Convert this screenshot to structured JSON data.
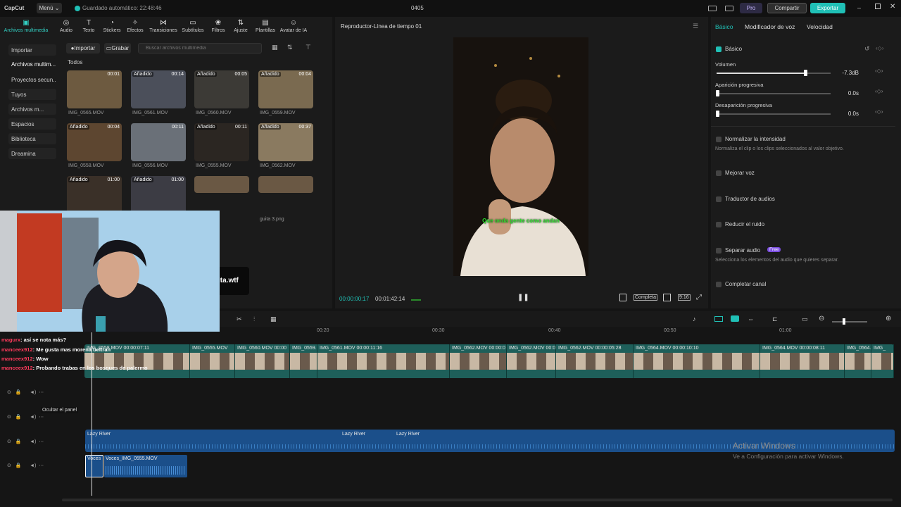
{
  "titlebar": {
    "logo": "CapCut",
    "menu_label": "Menú",
    "autosave": "Guardado automático: 22:48:46",
    "project_name": "0405",
    "pro_label": "Pro",
    "share_label": "Compartir",
    "export_label": "Exportar"
  },
  "toolbar": {
    "tools": [
      {
        "icon": "media-icon",
        "label": "Archivos multimedia"
      },
      {
        "icon": "audio-icon",
        "label": "Audio"
      },
      {
        "icon": "text-icon",
        "label": "Texto"
      },
      {
        "icon": "stickers-icon",
        "label": "Stickers"
      },
      {
        "icon": "effects-icon",
        "label": "Efectos"
      },
      {
        "icon": "transitions-icon",
        "label": "Transiciones"
      },
      {
        "icon": "subtitles-icon",
        "label": "Subtítulos"
      },
      {
        "icon": "filters-icon",
        "label": "Filtros"
      },
      {
        "icon": "adjust-icon",
        "label": "Ajuste"
      },
      {
        "icon": "templates-icon",
        "label": "Plantillas"
      },
      {
        "icon": "avatar-icon",
        "label": "Avatar de IA"
      }
    ]
  },
  "media": {
    "sidebar": [
      "Importar",
      "Archivos multim...",
      "Proyectos secun...",
      "Tuyos",
      "Archivos m...",
      "Espacios",
      "Biblioteca",
      "Dreamina"
    ],
    "import_label": "Importar",
    "record_label": "Grabar",
    "search_placeholder": "Buscar archivos multimedia",
    "section_label": "Todos",
    "added_label": "Añadido",
    "items": [
      {
        "name": "IMG_0565.MOV",
        "duration": "00:01",
        "added": false
      },
      {
        "name": "IMG_0561.MOV",
        "duration": "00:14",
        "added": true
      },
      {
        "name": "IMG_0560.MOV",
        "duration": "00:05",
        "added": true
      },
      {
        "name": "IMG_0559.MOV",
        "duration": "00:04",
        "added": true
      },
      {
        "name": "IMG_0558.MOV",
        "duration": "00:04",
        "added": true
      },
      {
        "name": "IMG_0556.MOV",
        "duration": "00:11",
        "added": false
      },
      {
        "name": "IMG_0555.MOV",
        "duration": "00:11",
        "added": true
      },
      {
        "name": "IMG_0562.MOV",
        "duration": "00:37",
        "added": true
      },
      {
        "name": "",
        "duration": "01:00",
        "added": true
      },
      {
        "name": "",
        "duration": "01:00",
        "added": true
      },
      {
        "name": "",
        "duration": "",
        "added": false
      },
      {
        "name": "guita 3.png",
        "duration": "",
        "added": false
      }
    ],
    "extra_thumb_text": "ita.wtf"
  },
  "player": {
    "title": "Reproductor-Línea de tiempo 01",
    "subtitle": "Que onda gente como andan",
    "current_time": "00:00:00:17",
    "total_time": "00:01:42:14",
    "full_label": "Completa",
    "ratio_label": "9:16"
  },
  "props": {
    "tabs": [
      "Básico",
      "Modificador de voz",
      "Velocidad"
    ],
    "section": "Básico",
    "volume_label": "Volumen",
    "volume_value": "-7.3dB",
    "volume_level": 0.78,
    "fade_in_label": "Aparición progresiva",
    "fade_in_value": "0.0s",
    "fade_out_label": "Desaparición progresiva",
    "fade_out_value": "0.0s",
    "normalize_label": "Normalizar la intensidad",
    "normalize_sub": "Normaliza el clip o los clips seleccionados al valor objetivo.",
    "improve_voice": "Mejorar voz",
    "translator": "Traductor de audios",
    "noise": "Reducir el ruido",
    "separate": "Separar audio",
    "separate_badge": "Free",
    "separate_sub": "Selecciona los elementos del audio que quieres separar.",
    "complete_channel": "Completar canal"
  },
  "timeline": {
    "ruler": [
      "00:20",
      "00:30",
      "00:40",
      "00:50",
      "01:00"
    ],
    "video_clips": [
      {
        "label": "IMG_0558.MOV  00:00:07:11"
      },
      {
        "label": "IMG_0555.MOV"
      },
      {
        "label": "IMG_0560.MOV  00:00"
      },
      {
        "label": "IMG_0559.M"
      },
      {
        "label": "IMG_0561.MOV  00:00:11:16"
      },
      {
        "label": "IMG_0562.MOV  00:00:0"
      },
      {
        "label": "IMG_0562.MOV  00:00"
      },
      {
        "label": "IMG_0562.MOV  00:00:05:28"
      },
      {
        "label": "IMG_0564.MOV  00:00:10:10"
      },
      {
        "label": "IMG_0564.MOV  00:00:08:11"
      },
      {
        "label": "IMG_0564.M"
      },
      {
        "label": "IMG_"
      }
    ],
    "music_labels": [
      "Lazy River",
      "Lazy River",
      "Lazy River"
    ],
    "voice_small": "Voces",
    "voice_clip": "Voces_IMG_0555.MOV",
    "tooltip": "Ocultar el panel"
  },
  "chat": [
    {
      "user": "magurx",
      "msg": ": así se nota más?"
    },
    {
      "user": "manceex912",
      "msg": ": Me gusta mas morena beltran"
    },
    {
      "user": "manceex912",
      "msg": ": Wow"
    },
    {
      "user": "manceex912",
      "msg": ": Probando trabas en los bosques de palermo"
    }
  ],
  "watermark": {
    "title": "Activar Windows",
    "sub": "Ve a Configuración para activar Windows."
  },
  "colors": {
    "accent": "#20c0b6",
    "clip_teal": "#1f6b66",
    "audio_blue": "#1b4f8a",
    "chat_user": "#ff3b5c"
  }
}
